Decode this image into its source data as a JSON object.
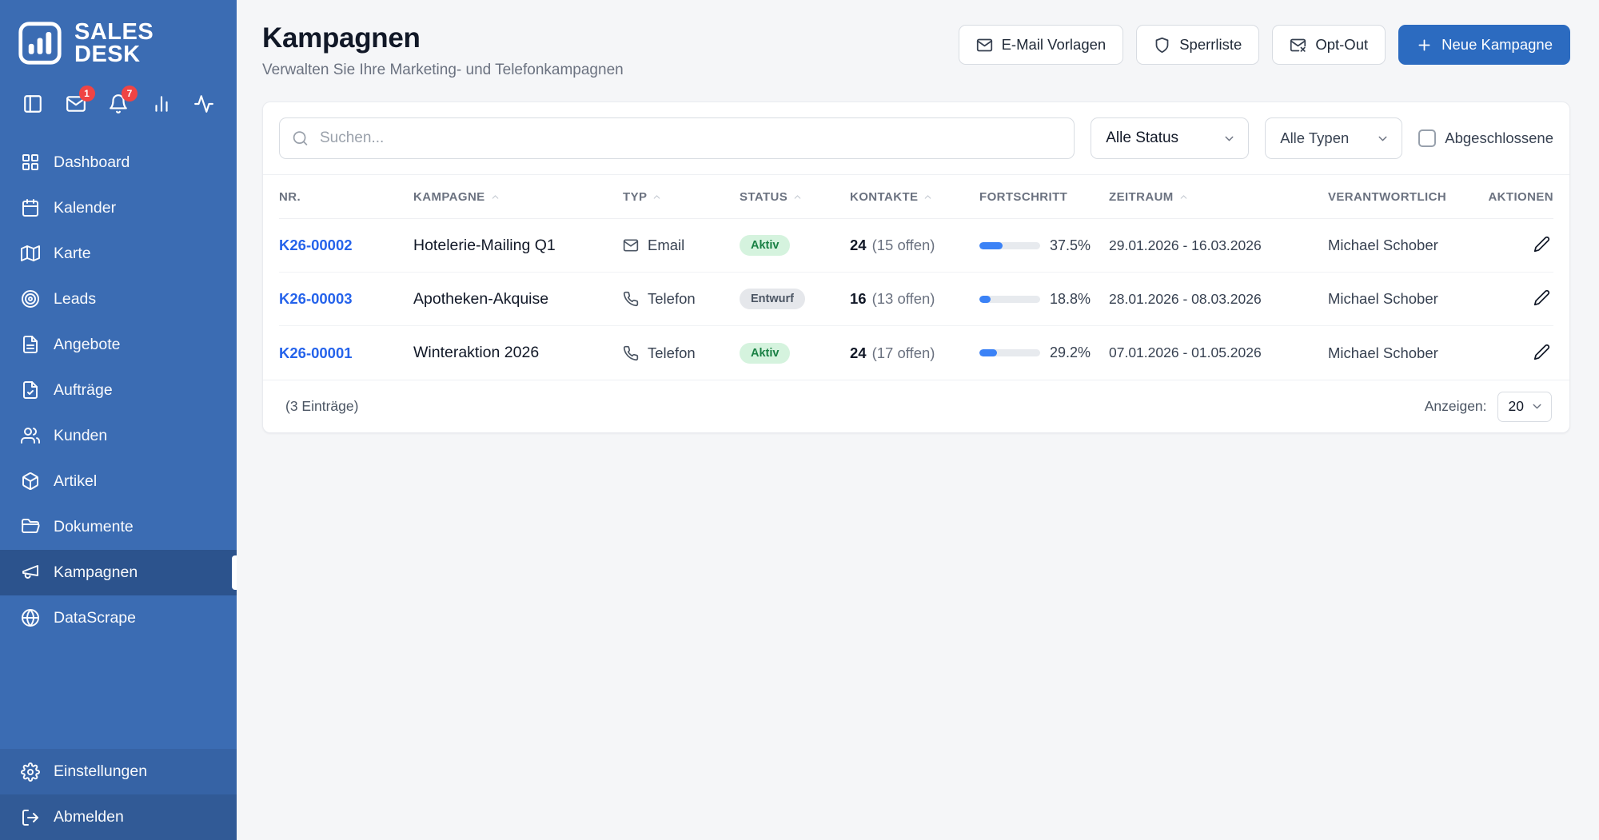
{
  "colors": {
    "sidebar_blue": "#3b6cb3",
    "sidebar_active": "#31568f",
    "accent_blue": "#2c6bc0",
    "link_blue": "#2563eb",
    "badge_red": "#ef4444",
    "status_active_bg": "#d5f3de",
    "status_active_text": "#198044",
    "status_draft_bg": "#e5e7eb",
    "status_draft_text": "#4b5563",
    "progress_fill": "#3b82f6"
  },
  "sidebar": {
    "logo_line1": "SALES",
    "logo_line2": "DESK",
    "top_icons": [
      {
        "key": "sidebar-toggle",
        "icon": "panel",
        "badge": null
      },
      {
        "key": "messages",
        "icon": "mail",
        "badge": "1"
      },
      {
        "key": "notifications",
        "icon": "bell",
        "badge": "7"
      },
      {
        "key": "stats",
        "icon": "chart",
        "badge": null
      },
      {
        "key": "activity",
        "icon": "activity",
        "badge": null
      }
    ],
    "items": [
      {
        "key": "dashboard",
        "label": "Dashboard",
        "icon": "grid",
        "active": false
      },
      {
        "key": "kalender",
        "label": "Kalender",
        "icon": "calendar",
        "active": false
      },
      {
        "key": "karte",
        "label": "Karte",
        "icon": "map",
        "active": false
      },
      {
        "key": "leads",
        "label": "Leads",
        "icon": "target",
        "active": false
      },
      {
        "key": "angebote",
        "label": "Angebote",
        "icon": "file-text",
        "active": false
      },
      {
        "key": "auftraege",
        "label": "Aufträge",
        "icon": "file-check",
        "active": false
      },
      {
        "key": "kunden",
        "label": "Kunden",
        "icon": "users",
        "active": false
      },
      {
        "key": "artikel",
        "label": "Artikel",
        "icon": "package",
        "active": false
      },
      {
        "key": "dokumente",
        "label": "Dokumente",
        "icon": "folder",
        "active": false
      },
      {
        "key": "kampagnen",
        "label": "Kampagnen",
        "icon": "megaphone",
        "active": true
      },
      {
        "key": "datascrape",
        "label": "DataScrape",
        "icon": "globe",
        "active": false
      }
    ],
    "bottom_items": [
      {
        "key": "einstellungen",
        "label": "Einstellungen",
        "icon": "settings"
      },
      {
        "key": "abmelden",
        "label": "Abmelden",
        "icon": "logout"
      }
    ]
  },
  "header": {
    "title": "Kampagnen",
    "subtitle": "Verwalten Sie Ihre Marketing- und Telefonkampagnen",
    "buttons": [
      {
        "key": "email-vorlagen",
        "label": "E-Mail Vorlagen",
        "icon": "mail"
      },
      {
        "key": "sperrliste",
        "label": "Sperrliste",
        "icon": "shield"
      },
      {
        "key": "opt-out",
        "label": "Opt-Out",
        "icon": "mail-x"
      }
    ],
    "primary_button": {
      "key": "neue-kampagne",
      "label": "Neue Kampagne",
      "icon": "plus"
    }
  },
  "filters": {
    "search_placeholder": "Suchen...",
    "status_select": "Alle Status",
    "type_select": "Alle Typen",
    "completed_checkbox_label": "Abgeschlossene",
    "completed_checked": false
  },
  "table": {
    "columns": [
      {
        "key": "nr",
        "label": "NR.",
        "sortable": false
      },
      {
        "key": "kampagne",
        "label": "KAMPAGNE",
        "sortable": true
      },
      {
        "key": "typ",
        "label": "TYP",
        "sortable": true
      },
      {
        "key": "status",
        "label": "STATUS",
        "sortable": true
      },
      {
        "key": "kontakte",
        "label": "KONTAKTE",
        "sortable": true
      },
      {
        "key": "fortschritt",
        "label": "FORTSCHRITT",
        "sortable": false
      },
      {
        "key": "zeitraum",
        "label": "ZEITRAUM",
        "sortable": true
      },
      {
        "key": "verantwortlich",
        "label": "VERANTWORTLICH",
        "sortable": false
      },
      {
        "key": "aktionen",
        "label": "AKTIONEN",
        "sortable": false
      }
    ],
    "rows": [
      {
        "nr": "K26-00002",
        "campaign": "Hotelerie-Mailing Q1",
        "type": "Email",
        "type_icon": "mail",
        "status": "Aktiv",
        "status_kind": "active",
        "contacts": "24",
        "contacts_open": "(15 offen)",
        "progress_pct": 37.5,
        "progress_label": "37.5%",
        "period": "29.01.2026 - 16.03.2026",
        "owner": "Michael Schober"
      },
      {
        "nr": "K26-00003",
        "campaign": "Apotheken-Akquise",
        "type": "Telefon",
        "type_icon": "phone",
        "status": "Entwurf",
        "status_kind": "draft",
        "contacts": "16",
        "contacts_open": "(13 offen)",
        "progress_pct": 18.8,
        "progress_label": "18.8%",
        "period": "28.01.2026 - 08.03.2026",
        "owner": "Michael Schober"
      },
      {
        "nr": "K26-00001",
        "campaign": "Winteraktion 2026",
        "type": "Telefon",
        "type_icon": "phone",
        "status": "Aktiv",
        "status_kind": "active",
        "contacts": "24",
        "contacts_open": "(17 offen)",
        "progress_pct": 29.2,
        "progress_label": "29.2%",
        "period": "07.01.2026 - 01.05.2026",
        "owner": "Michael Schober"
      }
    ],
    "footer": {
      "entries_label": "(3 Einträge)",
      "show_label": "Anzeigen:",
      "page_size": "20"
    }
  }
}
